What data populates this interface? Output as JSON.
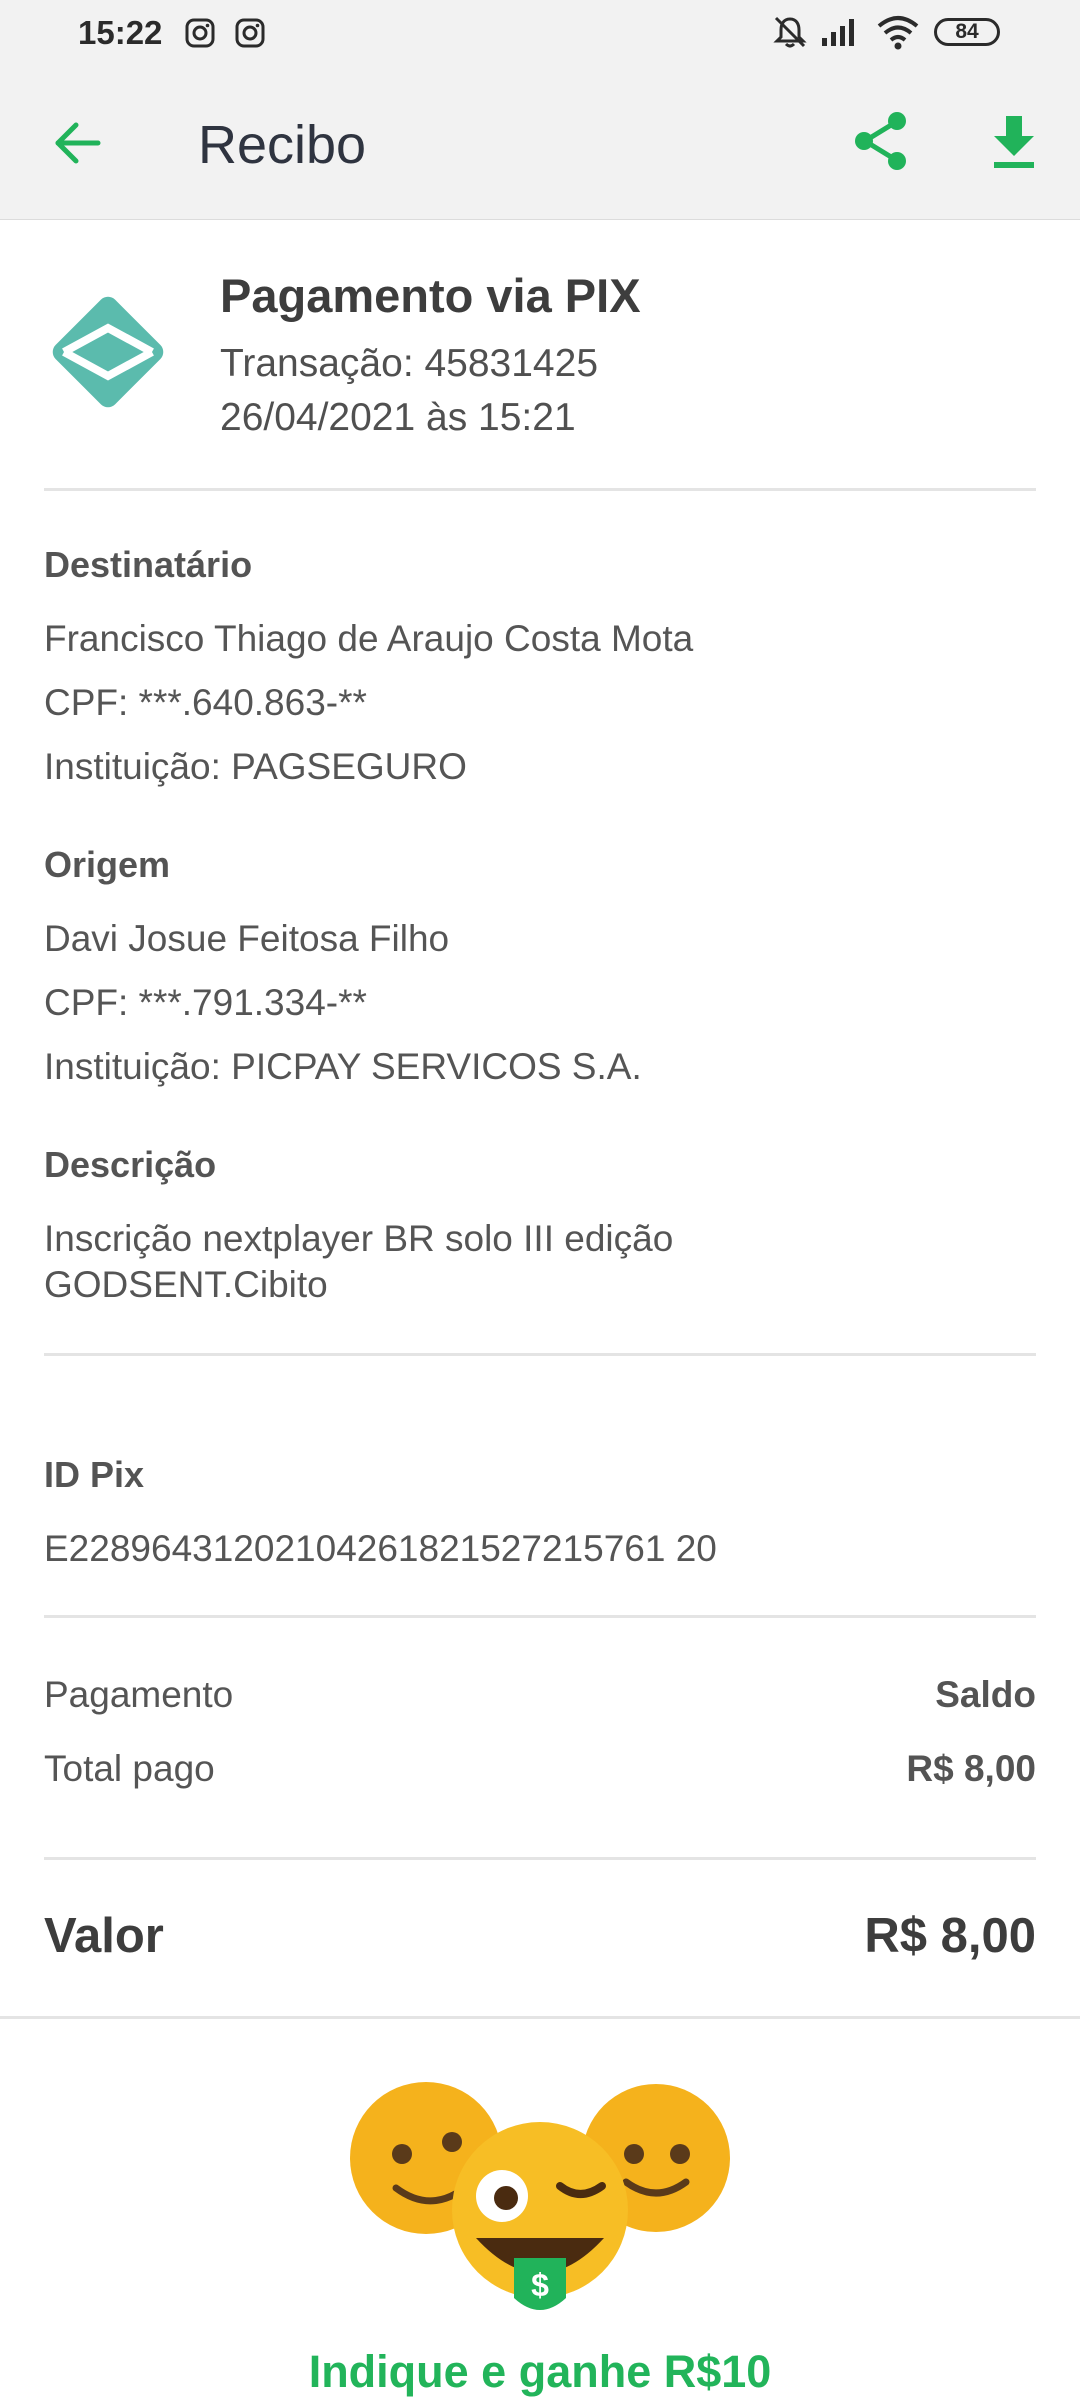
{
  "status_bar": {
    "time": "15:22",
    "battery": "84",
    "icons": [
      "instagram-icon",
      "instagram-icon",
      "mute-icon",
      "signal-icon",
      "wifi-icon",
      "battery-icon"
    ]
  },
  "app_bar": {
    "title": "Recibo",
    "accent_color": "#21b35a"
  },
  "header": {
    "title": "Pagamento via PIX",
    "transaction": "Transação: 45831425",
    "datetime": "26/04/2021 às 15:21",
    "logo": "pix-logo",
    "logo_color": "#5bbbad"
  },
  "destinatario": {
    "label": "Destinatário",
    "name": "Francisco Thiago de Araujo Costa Mota",
    "cpf": "CPF: ***.640.863-**",
    "institution": "Instituição: PAGSEGURO"
  },
  "origem": {
    "label": "Origem",
    "name": "Davi Josue Feitosa Filho",
    "cpf": "CPF: ***.791.334-**",
    "institution": "Instituição: PICPAY SERVICOS S.A."
  },
  "descricao": {
    "label": "Descrição",
    "line1": "Inscrição nextplayer BR solo III edição",
    "line2": "GODSENT.Cibito"
  },
  "id_pix": {
    "label": "ID Pix",
    "value": "E22896431202104261821527215761 20"
  },
  "payment": {
    "method_label": "Pagamento",
    "method_value": "Saldo",
    "total_label": "Total pago",
    "total_value": "R$ 8,00"
  },
  "valor": {
    "label": "Valor",
    "value": "R$ 8,00"
  },
  "promo": {
    "text": "Indique e ganhe R$10"
  }
}
